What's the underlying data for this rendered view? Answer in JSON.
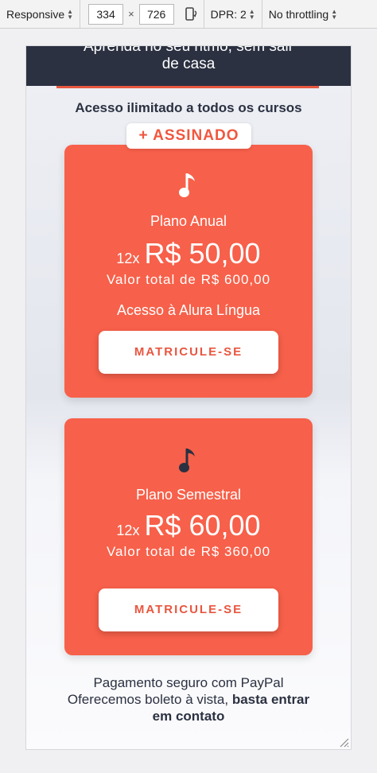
{
  "devtools": {
    "device": "Responsive",
    "width": "334",
    "times": "×",
    "height": "726",
    "dpr": "DPR: 2",
    "throttling": "No throttling"
  },
  "page": {
    "hero_line1": "Aprenda no seu ritmo, sem sair",
    "hero_line2": "de casa",
    "headline": "Acesso ilimitado a todos os cursos",
    "badge": "+ ASSINADO",
    "plans": [
      {
        "name": "Plano Anual",
        "installments": "12x",
        "price": "R$ 50,00",
        "total": "Valor total de R$ 600,00",
        "extra": "Acesso à Alura Língua",
        "cta": "MATRICULE-SE"
      },
      {
        "name": "Plano Semestral",
        "installments": "12x",
        "price": "R$ 60,00",
        "total": "Valor total de R$ 360,00",
        "cta": "MATRICULE-SE"
      }
    ],
    "footer_line1": "Pagamento seguro com PayPal",
    "footer_line2_regular": "Oferecemos boleto à vista,",
    "footer_line2_bold": "basta entrar",
    "footer_line3_bold": "em contato"
  },
  "icons": {
    "dropdown": "dropdown-arrows-icon",
    "rotate": "rotate-device-icon",
    "note_white": "music-note-icon",
    "note_dark": "music-note-icon",
    "resize": "resize-handle-icon"
  },
  "colors": {
    "card": "#f7604a",
    "hero": "#2b3141",
    "accent": "#e8563f"
  }
}
